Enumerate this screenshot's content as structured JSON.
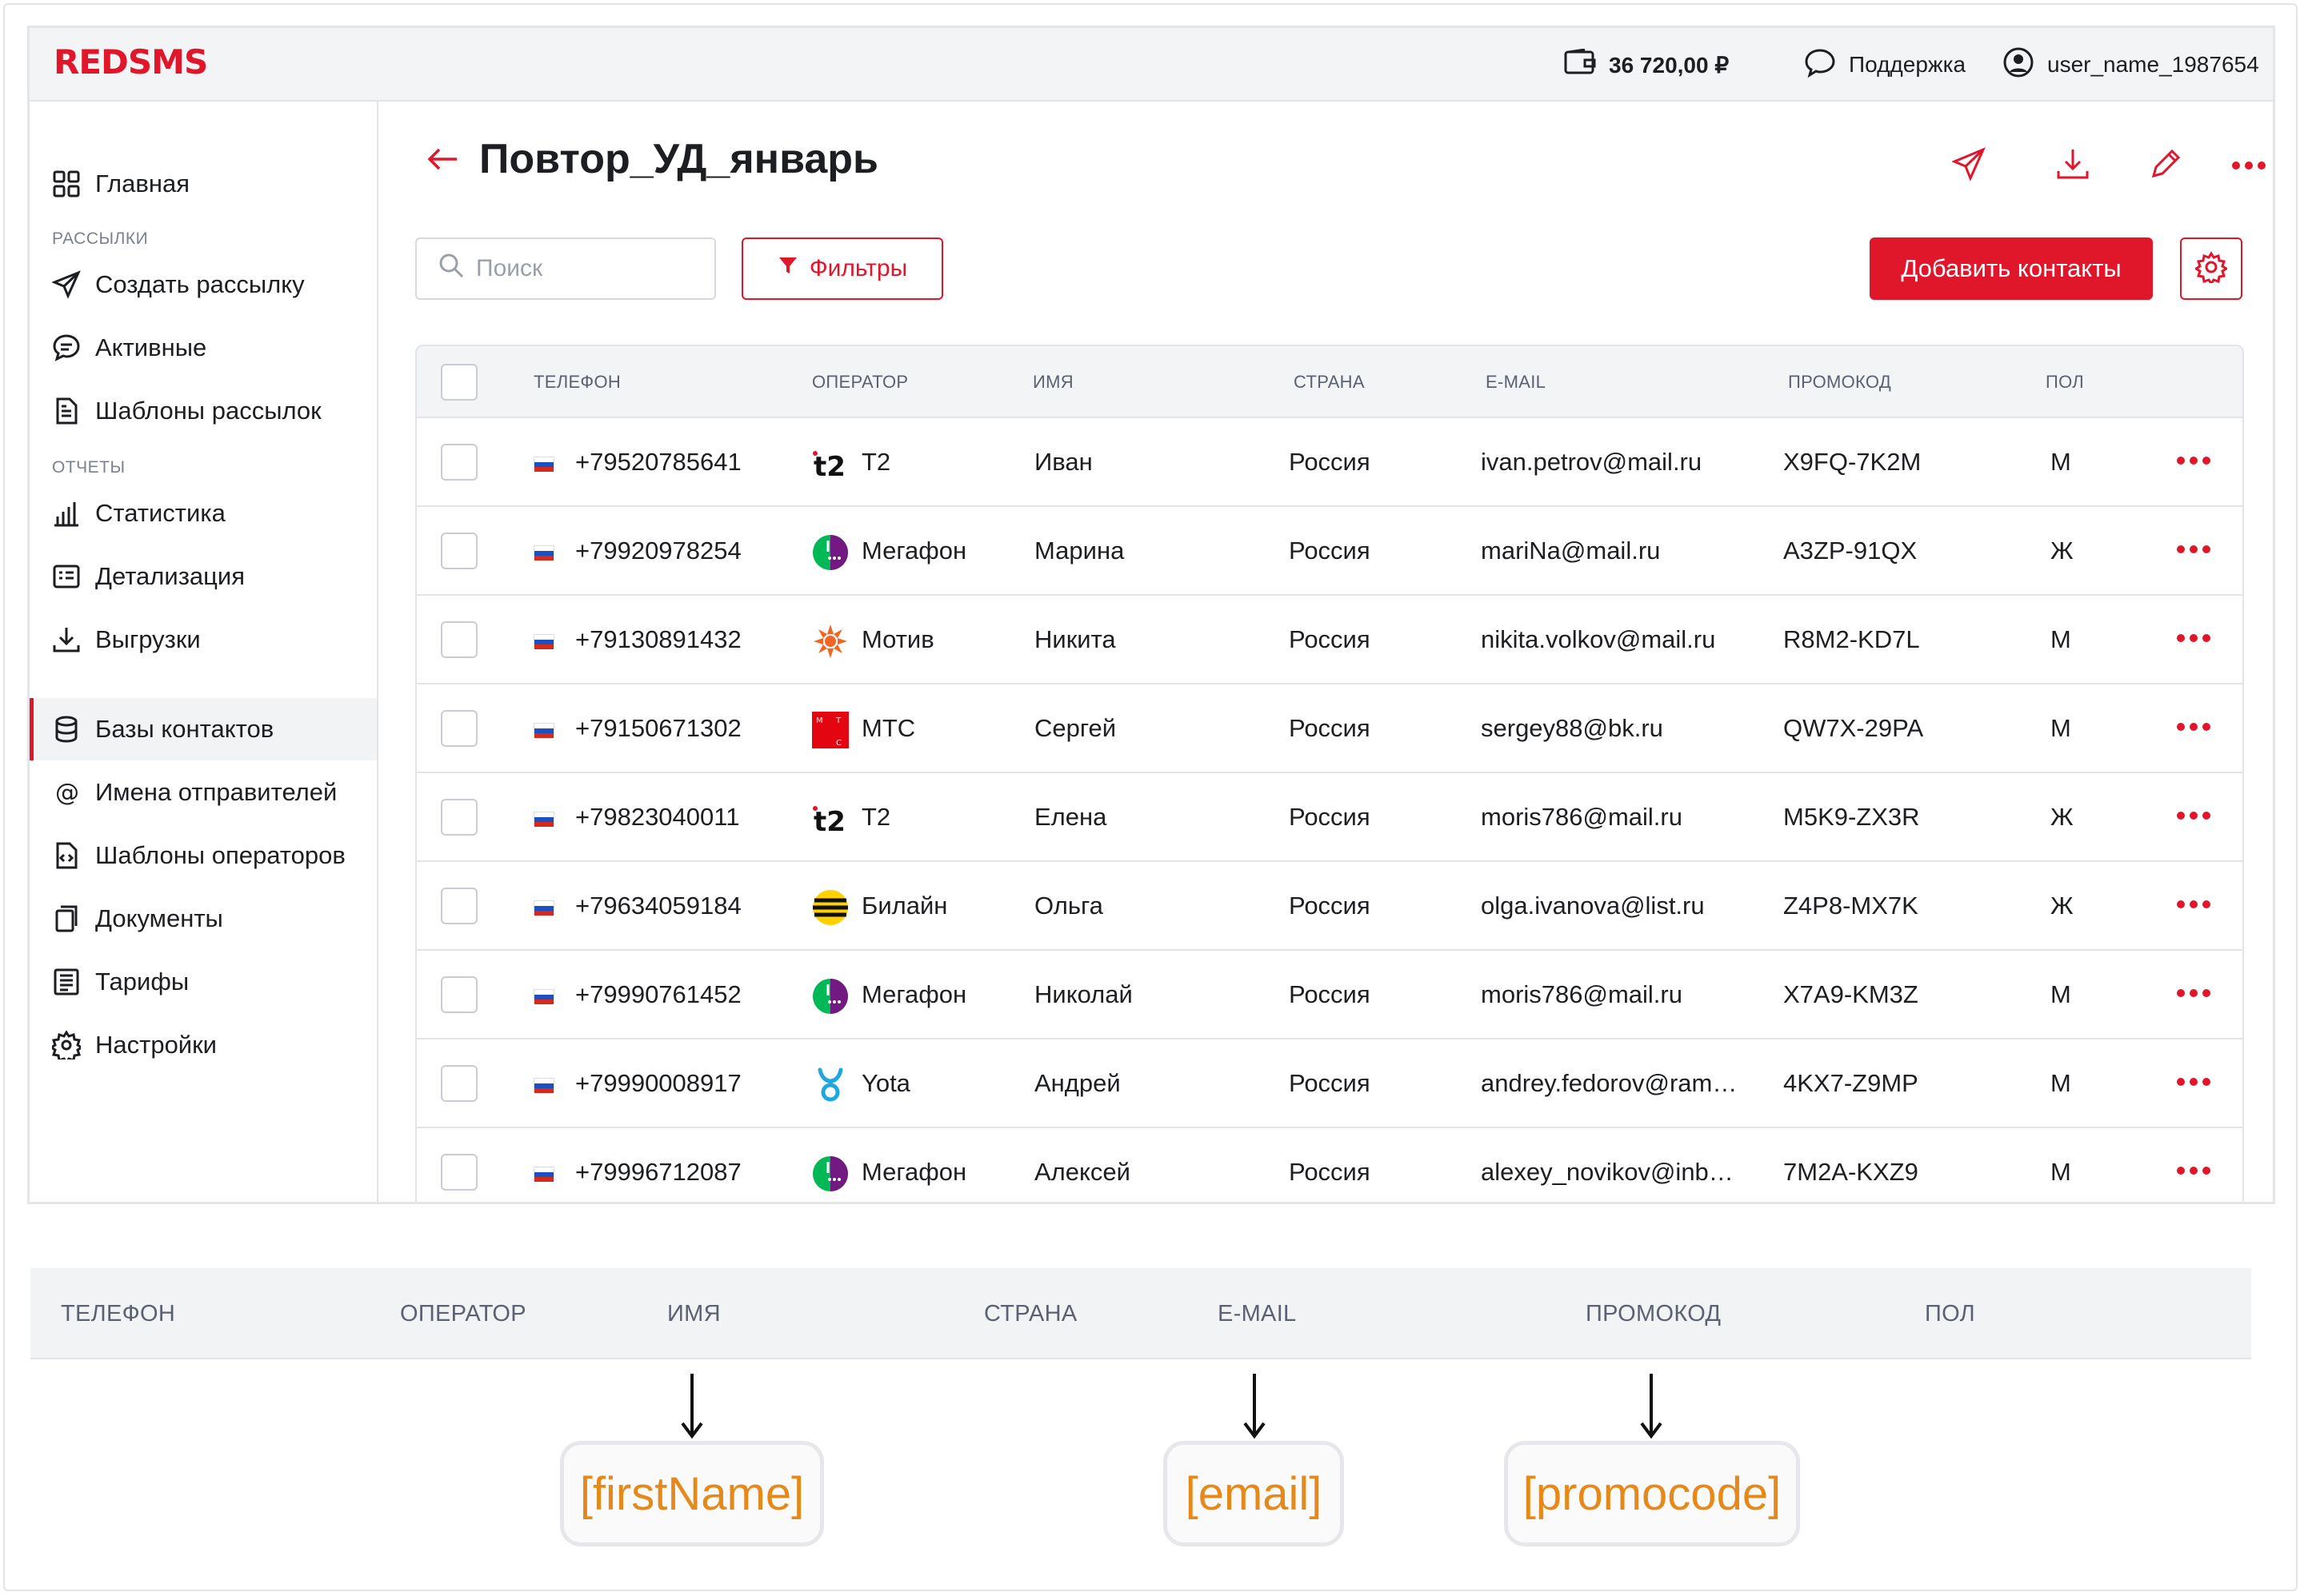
{
  "app": {
    "logo": "REDSMS",
    "balance": "36 720,00 ₽",
    "support": "Поддержка",
    "user": "user_name_1987654"
  },
  "sidebar": {
    "home": "Главная",
    "section_mailings": "РАССЫЛКИ",
    "create": "Создать рассылку",
    "active": "Активные",
    "templates": "Шаблоны рассылок",
    "section_reports": "ОТЧЕТЫ",
    "stats": "Статистика",
    "details": "Детализация",
    "exports": "Выгрузки",
    "contacts": "Базы контактов",
    "senders": "Имена отправителей",
    "op_templates": "Шаблоны операторов",
    "documents": "Документы",
    "tariffs": "Тарифы",
    "settings": "Настройки"
  },
  "page": {
    "title": "Повтор_УД_январь",
    "search_placeholder": "Поиск",
    "filters": "Фильтры",
    "add_contacts": "Добавить контакты"
  },
  "table": {
    "headers": {
      "phone": "ТЕЛЕФОН",
      "operator": "ОПЕРАТОР",
      "name": "ИМЯ",
      "country": "СТРАНА",
      "email": "E-MAIL",
      "promo": "ПРОМОКОД",
      "gender": "ПОЛ"
    },
    "rows": [
      {
        "phone": "+79520785641",
        "operator": "T2",
        "logo": "t2-logo",
        "name": "Иван",
        "country": "Россия",
        "email": "ivan.petrov@mail.ru",
        "promo": "X9FQ-7K2M",
        "gender": "М"
      },
      {
        "phone": "+79920978254",
        "operator": "Мегафон",
        "logo": "megafon-logo",
        "name": "Марина",
        "country": "Россия",
        "email": "mariNa@mail.ru",
        "promo": "A3ZP-91QX",
        "gender": "Ж"
      },
      {
        "phone": "+79130891432",
        "operator": "Мотив",
        "logo": "motiv-logo",
        "name": "Никита",
        "country": "Россия",
        "email": "nikita.volkov@mail.ru",
        "promo": "R8M2-KD7L",
        "gender": "М"
      },
      {
        "phone": "+79150671302",
        "operator": "МТС",
        "logo": "mts-logo",
        "name": "Сергей",
        "country": "Россия",
        "email": "sergey88@bk.ru",
        "promo": "QW7X-29PA",
        "gender": "М"
      },
      {
        "phone": "+79823040011",
        "operator": "T2",
        "logo": "t2-logo",
        "name": "Елена",
        "country": "Россия",
        "email": "moris786@mail.ru",
        "promo": "M5K9-ZX3R",
        "gender": "Ж"
      },
      {
        "phone": "+79634059184",
        "operator": "Билайн",
        "logo": "beeline-logo",
        "name": "Ольга",
        "country": "Россия",
        "email": "olga.ivanova@list.ru",
        "promo": "Z4P8-MX7K",
        "gender": "Ж"
      },
      {
        "phone": "+79990761452",
        "operator": "Мегафон",
        "logo": "megafon-logo",
        "name": "Николай",
        "country": "Россия",
        "email": "moris786@mail.ru",
        "promo": "X7A9-KM3Z",
        "gender": "М"
      },
      {
        "phone": "+79990008917",
        "operator": "Yota",
        "logo": "yota-logo",
        "name": "Андрей",
        "country": "Россия",
        "email": "andrey.fedorov@ram…",
        "promo": "4KX7-Z9MP",
        "gender": "М"
      },
      {
        "phone": "+79996712087",
        "operator": "Мегафон",
        "logo": "megafon-logo",
        "name": "Алексей",
        "country": "Россия",
        "email": "alexey_novikov@inb…",
        "promo": "7M2A-KXZ9",
        "gender": "М"
      }
    ]
  },
  "mapping": {
    "headers": [
      "ТЕЛЕФОН",
      "ОПЕРАТОР",
      "ИМЯ",
      "СТРАНА",
      "E-MAIL",
      "ПРОМОКОД",
      "ПОЛ"
    ],
    "placeholders": {
      "name": "[firstName]",
      "email": "[email]",
      "promo": "[promocode]"
    }
  },
  "colors": {
    "accent": "#e0162b",
    "placeholder_text": "#e58a1a"
  }
}
